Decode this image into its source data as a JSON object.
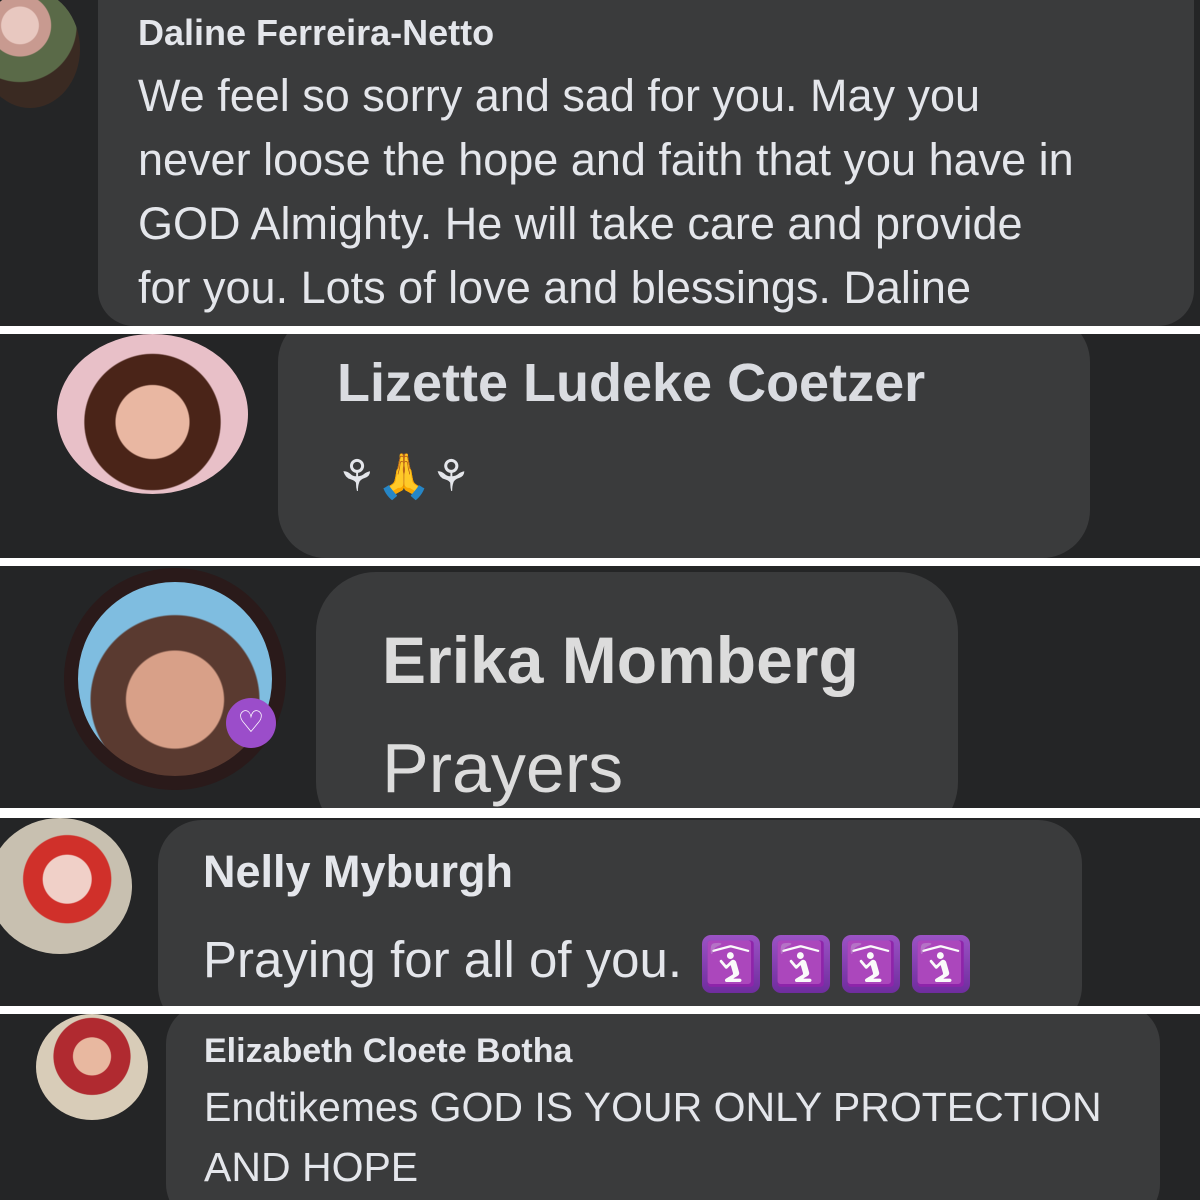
{
  "comments": [
    {
      "author": "Daline Ferreira-Netto",
      "lines": [
        "We feel so sorry and sad for you.  May you",
        "never loose the hope and faith that you have in",
        "GOD Almighty.  He will take care and provide",
        "for you.  Lots of love and blessings.  Daline"
      ]
    },
    {
      "author": "Lizette Ludeke Coetzer",
      "emoji": "⚘🙏⚘"
    },
    {
      "author": "Erika Momberg",
      "text": "Prayers",
      "badge_icon": "♡"
    },
    {
      "author": "Nelly Myburgh",
      "text": "Praying for all of you.",
      "emoji_tiles": [
        "🛐",
        "🛐",
        "🛐",
        "🛐"
      ]
    },
    {
      "author": "Elizabeth Cloete Botha",
      "lines": [
        "Endtikemes GOD IS YOUR ONLY PROTECTION",
        "AND HOPE"
      ]
    }
  ],
  "colors": {
    "background": "#242526",
    "bubble": "#3a3b3c",
    "text": "#e4e6eb",
    "separator": "#ffffff",
    "emoji_tile": "#8e44c0"
  }
}
